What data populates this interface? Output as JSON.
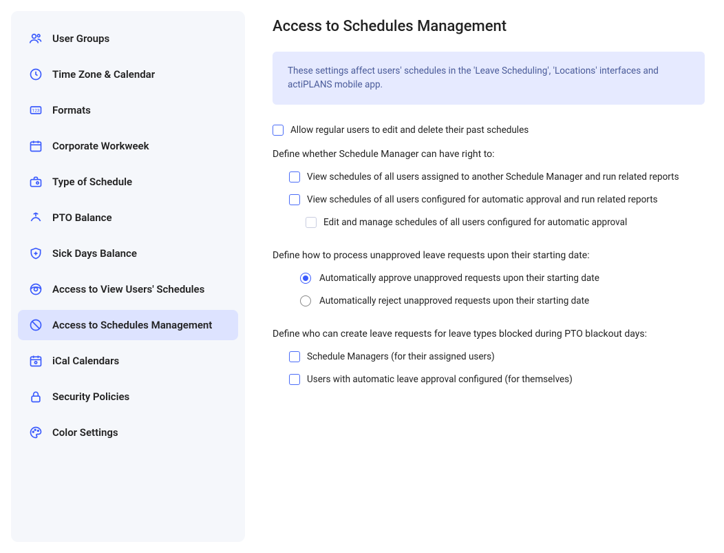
{
  "sidebar": {
    "items": [
      {
        "label": "User Groups"
      },
      {
        "label": "Time Zone & Calendar"
      },
      {
        "label": "Formats"
      },
      {
        "label": "Corporate Workweek"
      },
      {
        "label": "Type of Schedule"
      },
      {
        "label": "PTO Balance"
      },
      {
        "label": "Sick Days Balance"
      },
      {
        "label": "Access to View Users' Schedules"
      },
      {
        "label": "Access to Schedules Management"
      },
      {
        "label": "iCal Calendars"
      },
      {
        "label": "Security Policies"
      },
      {
        "label": "Color Settings"
      }
    ]
  },
  "main": {
    "title": "Access to Schedules Management",
    "info": "These settings affect users' schedules in the 'Leave Scheduling', 'Locations' interfaces and actiPLANS mobile app.",
    "allow_past": "Allow regular users to edit and delete their past schedules",
    "section1": "Define whether Schedule Manager can have right to:",
    "opt1": "View schedules of all users assigned to another Schedule Manager and run related reports",
    "opt2": "View schedules of all users configured for automatic approval and run related reports",
    "opt2a": "Edit and manage schedules of all users configured for automatic approval",
    "section2": "Define how to process unapproved leave requests upon their starting date:",
    "radio1": "Automatically approve unapproved requests upon their starting date",
    "radio2": "Automatically reject unapproved requests upon their starting date",
    "section3": "Define who can create leave requests for leave types blocked during PTO blackout days:",
    "opt3": "Schedule Managers (for their assigned users)",
    "opt4": "Users with automatic leave approval configured (for themselves)"
  }
}
